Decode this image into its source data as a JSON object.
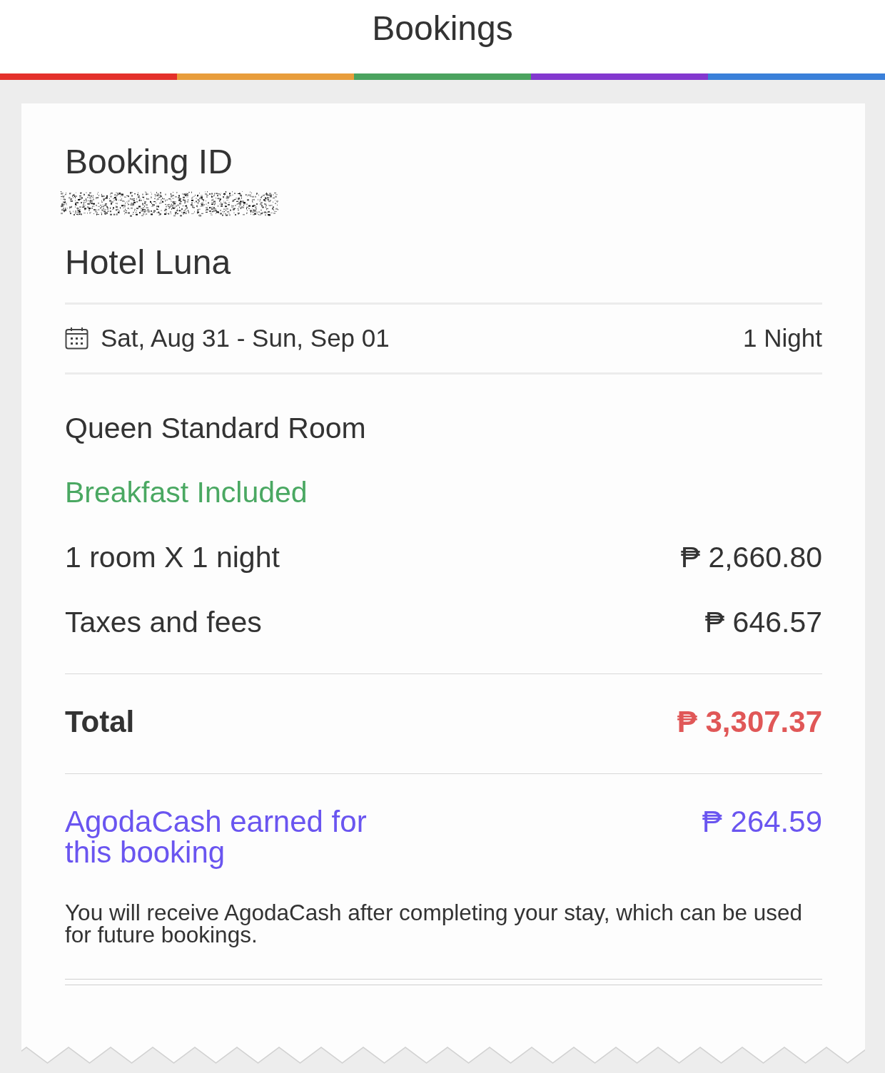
{
  "header": {
    "title": "Bookings",
    "stripe": [
      {
        "color": "#e4312b"
      },
      {
        "color": "#e89d3b"
      },
      {
        "color": "#4ba35f"
      },
      {
        "color": "#8338cf"
      },
      {
        "color": "#3a80d9"
      }
    ]
  },
  "booking": {
    "id_label": "Booking ID",
    "hotel": "Hotel Luna"
  },
  "stay": {
    "dates": "Sat, Aug 31 - Sun, Sep 01",
    "nights": "1 Night"
  },
  "room": {
    "name": "Queen Standard Room",
    "perk": "Breakfast Included"
  },
  "charges": [
    {
      "label": "1 room X 1 night",
      "amount": "₱ 2,660.80"
    },
    {
      "label": "Taxes and fees",
      "amount": "₱ 646.57"
    }
  ],
  "total": {
    "label": "Total",
    "amount": "₱ 3,307.37"
  },
  "cashback": {
    "label": "AgodaCash earned for this booking",
    "amount": "₱ 264.59",
    "note": "You will receive AgodaCash after completing your stay, which can be used for future bookings."
  }
}
